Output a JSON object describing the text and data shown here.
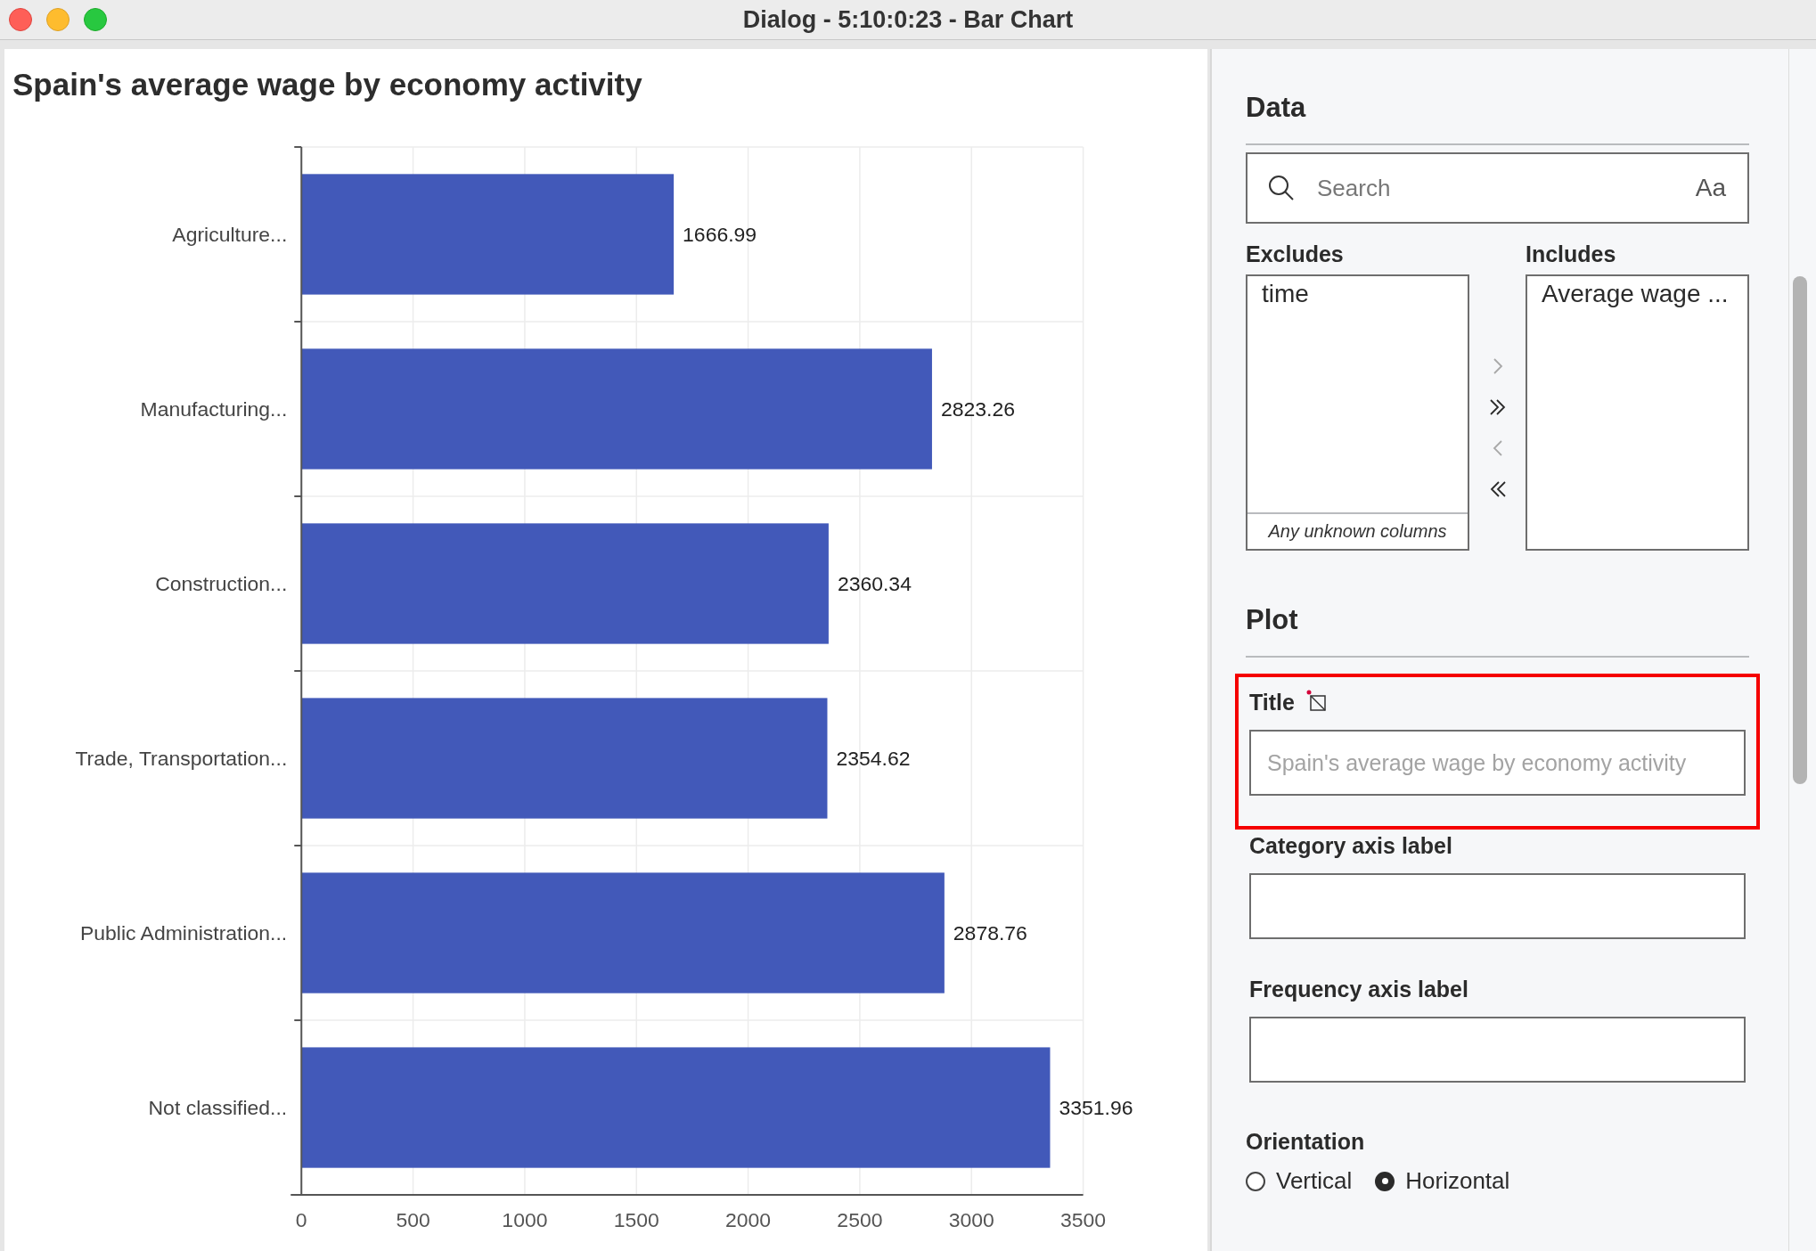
{
  "window": {
    "title": "Dialog - 5:10:0:23 - Bar Chart"
  },
  "chart_panel": {
    "chart_data": {
      "type": "bar",
      "orientation": "horizontal",
      "title": "Spain's average wage by economy activity",
      "categories": [
        "Agriculture...",
        "Manufacturing...",
        "Construction...",
        "Trade, Transportation...",
        "Public Administration...",
        "Not classified..."
      ],
      "series": [
        {
          "color": "#4259b9",
          "values": [
            1666.99,
            2823.26,
            2360.34,
            2354.62,
            2878.76,
            3351.96
          ]
        }
      ],
      "xlim": [
        0,
        3500
      ],
      "xticks": [
        0,
        500,
        1000,
        1500,
        2000,
        2500,
        3000,
        3500
      ],
      "data_labels": true,
      "grid": true
    }
  },
  "data_section": {
    "heading": "Data",
    "search": {
      "placeholder": "Search",
      "case_toggle": "Aa"
    },
    "excludes": {
      "label": "Excludes",
      "items": [
        "time"
      ],
      "footer": "Any unknown columns"
    },
    "transfer_buttons": [
      {
        "kind": "move_right",
        "disabled": true
      },
      {
        "kind": "move_all_right",
        "disabled": false
      },
      {
        "kind": "move_left",
        "disabled": true
      },
      {
        "kind": "move_all_left",
        "disabled": false
      }
    ],
    "includes": {
      "label": "Includes",
      "items": [
        "Average wage ..."
      ]
    }
  },
  "plot_section": {
    "heading": "Plot",
    "fields": [
      {
        "label": "Title",
        "placeholder": "Spain's average wage by economy activity",
        "highlighted": true,
        "modified": true
      },
      {
        "label": "Category axis label",
        "highlighted": false,
        "modified": false
      },
      {
        "label": "Frequency axis label",
        "highlighted": false,
        "modified": false
      }
    ],
    "orientation": {
      "label": "Orientation",
      "options": [
        {
          "label": "Vertical",
          "selected": false
        },
        {
          "label": "Horizontal",
          "selected": true
        }
      ]
    }
  }
}
